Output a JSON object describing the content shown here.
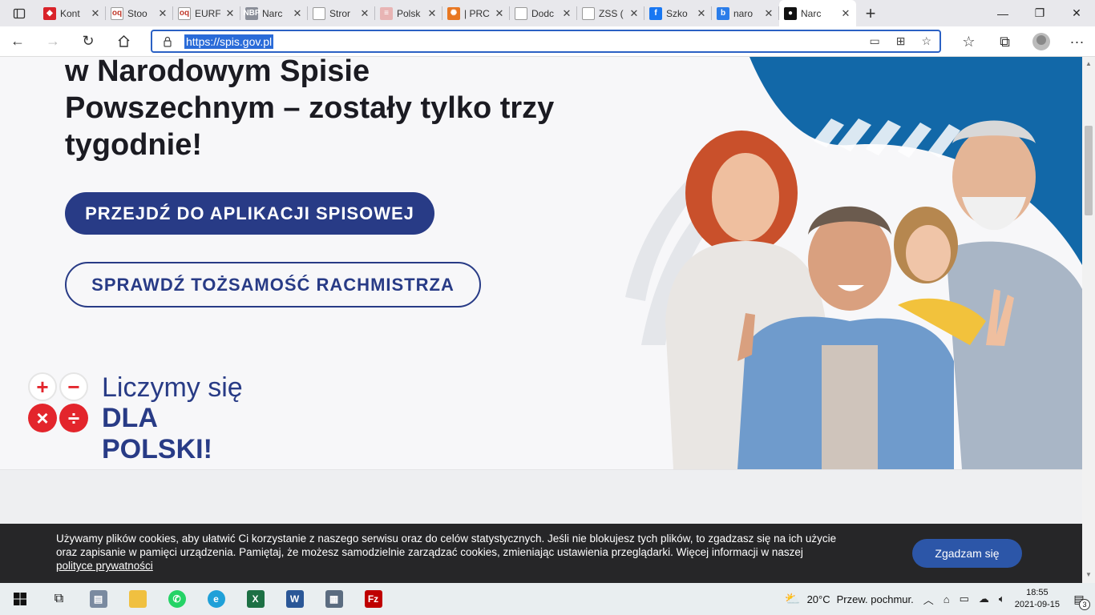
{
  "browser": {
    "tabs": [
      {
        "label": "Kont",
        "color": "#d9232a",
        "glyph": "◆"
      },
      {
        "label": "Stoo",
        "color": "#ffffff",
        "glyph": "oq"
      },
      {
        "label": "EURF",
        "color": "#ffffff",
        "glyph": "oq"
      },
      {
        "label": "Narc",
        "color": "#8b8f99",
        "glyph": "NBP"
      },
      {
        "label": "Stror",
        "color": "#ffffff",
        "glyph": ""
      },
      {
        "label": "Polsk",
        "color": "#e8b4b4",
        "glyph": "≡"
      },
      {
        "label": "| PRC",
        "color": "#e87722",
        "glyph": "✺"
      },
      {
        "label": "Dodc",
        "color": "#ffffff",
        "glyph": ""
      },
      {
        "label": "ZSS (",
        "color": "#ffffff",
        "glyph": ""
      },
      {
        "label": "Szko",
        "color": "#1877f2",
        "glyph": "f"
      },
      {
        "label": "naro",
        "color": "#2b7de9",
        "glyph": "b"
      },
      {
        "label": "Narc",
        "color": "#111111",
        "glyph": "●",
        "active": true
      }
    ],
    "url": "https://spis.gov.pl"
  },
  "hero": {
    "heading_line1": "w Narodowym Spisie",
    "heading_line2": "Powszechnym – zostały tylko trzy",
    "heading_line3": "tygodnie!",
    "primary_button": "PRZEJDŹ DO APLIKACJI SPISOWEJ",
    "secondary_button": "SPRAWDŹ TOŻSAMOŚĆ RACHMISTRZA"
  },
  "logo": {
    "line1": "Liczymy się",
    "line2": "DLA POLSKI!",
    "symbols": [
      "+",
      "−",
      "×",
      "÷"
    ]
  },
  "cookie": {
    "text_line1": "Używamy plików cookies, aby ułatwić Ci korzystanie z naszego serwisu oraz do celów statystycznych. Jeśli nie blokujesz tych plików, to zgadzasz się na ich użycie",
    "text_line2": "oraz zapisanie w pamięci urządzenia. Pamiętaj, że możesz samodzielnie zarządzać cookies, zmieniając ustawienia przeglądarki. Więcej informacji w naszej",
    "link": "polityce prywatności",
    "accept_button": "Zgadzam się"
  },
  "taskbar": {
    "temperature": "20°C",
    "weather": "Przew. pochmur.",
    "time": "18:55",
    "date": "2021-09-15",
    "notifications": "3"
  },
  "colors": {
    "brand_navy": "#283b86",
    "brand_red": "#e3252c",
    "cookie_button": "#2c56a8",
    "address_focus": "#2b61c4"
  }
}
